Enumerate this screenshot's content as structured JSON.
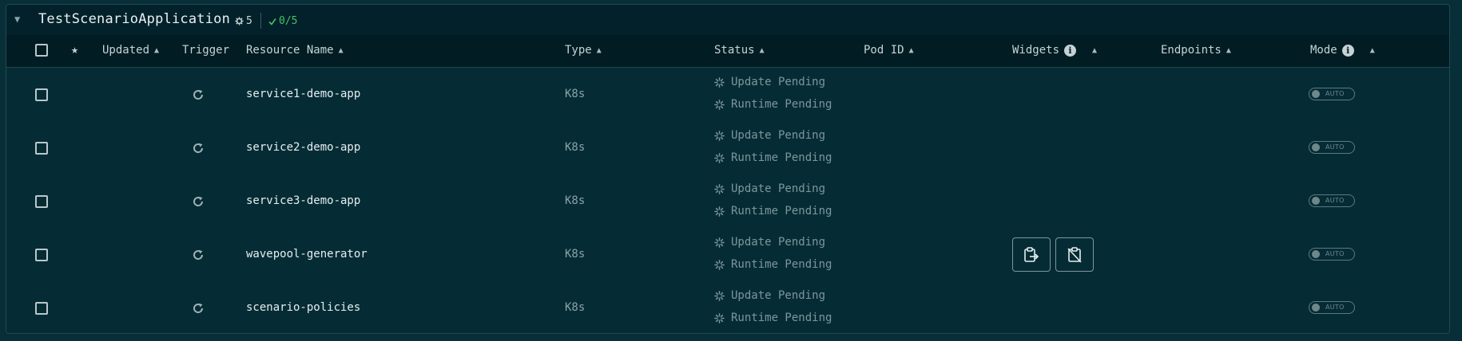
{
  "group": {
    "name": "TestScenarioApplication",
    "resource_count": "5",
    "ok_status": "0/5",
    "icons": {
      "collapse": "triangle-down-icon",
      "resources": "gear-icon",
      "ok": "checkmark-icon"
    }
  },
  "columns": {
    "select_all": "",
    "star": "★",
    "updated": "Updated",
    "trigger": "Trigger",
    "resource_name": "Resource Name",
    "type": "Type",
    "status": "Status",
    "pod_id": "Pod ID",
    "widgets": "Widgets",
    "endpoints": "Endpoints",
    "mode": "Mode",
    "sort_glyph": "▲",
    "info_glyph": "i"
  },
  "rows": [
    {
      "name": "service1-demo-app",
      "type": "K8s",
      "status_update": "Update Pending",
      "status_runtime": "Runtime Pending",
      "mode": "AUTO",
      "widgets": []
    },
    {
      "name": "service2-demo-app",
      "type": "K8s",
      "status_update": "Update Pending",
      "status_runtime": "Runtime Pending",
      "mode": "AUTO",
      "widgets": []
    },
    {
      "name": "service3-demo-app",
      "type": "K8s",
      "status_update": "Update Pending",
      "status_runtime": "Runtime Pending",
      "mode": "AUTO",
      "widgets": []
    },
    {
      "name": "wavepool-generator",
      "type": "K8s",
      "status_update": "Update Pending",
      "status_runtime": "Runtime Pending",
      "mode": "AUTO",
      "widgets": [
        "clipboard-export-icon",
        "clipboard-disabled-icon"
      ]
    },
    {
      "name": "scenario-policies",
      "type": "K8s",
      "status_update": "Update Pending",
      "status_runtime": "Runtime Pending",
      "mode": "AUTO",
      "widgets": []
    }
  ],
  "colors": {
    "background": "#082f38",
    "row": "#052c35",
    "header": "#021c23",
    "ok_green": "#43c06a",
    "muted_text": "#7d969c"
  }
}
